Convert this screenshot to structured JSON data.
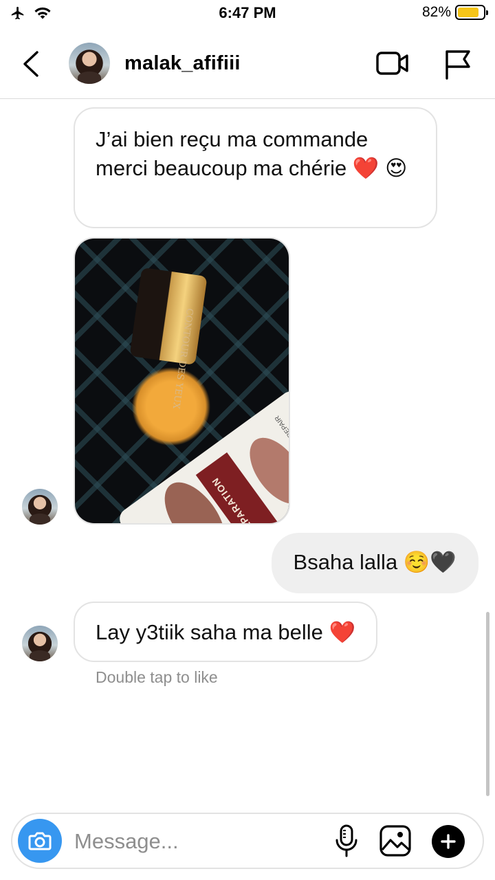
{
  "status_bar": {
    "time": "6:47 PM",
    "battery_percent": "82%",
    "battery_level": 0.82,
    "icons": [
      "airplane-icon",
      "wifi-icon",
      "battery-icon"
    ]
  },
  "header": {
    "username": "malak_afifiii",
    "icons": [
      "back-chevron-icon",
      "video-camera-icon",
      "flag-icon"
    ]
  },
  "messages": [
    {
      "direction": "incoming",
      "type": "text",
      "text": "J’ai bien reçu ma commande merci beaucoup ma chérie ❤️ 😍"
    },
    {
      "direction": "incoming",
      "type": "image",
      "image_text": [
        "CONTOUR DES YEUX",
        "RÉPARATION",
        "REPAIR"
      ]
    },
    {
      "direction": "outgoing",
      "type": "text",
      "text": "Bsaha lalla ☺️🖤"
    },
    {
      "direction": "incoming",
      "type": "text",
      "text": "Lay y3tiik saha ma belle ❤️"
    }
  ],
  "hint": "Double tap to like",
  "composer": {
    "placeholder": "Message...",
    "value": "",
    "icons": [
      "camera-icon",
      "microphone-icon",
      "gallery-icon",
      "plus-icon"
    ]
  },
  "colors": {
    "accent": "#3797f0",
    "bubble_outgoing": "#efefef",
    "bubble_incoming_border": "#e3e3e3",
    "battery": "#f5c518",
    "hint_text": "#8e8e8e"
  }
}
